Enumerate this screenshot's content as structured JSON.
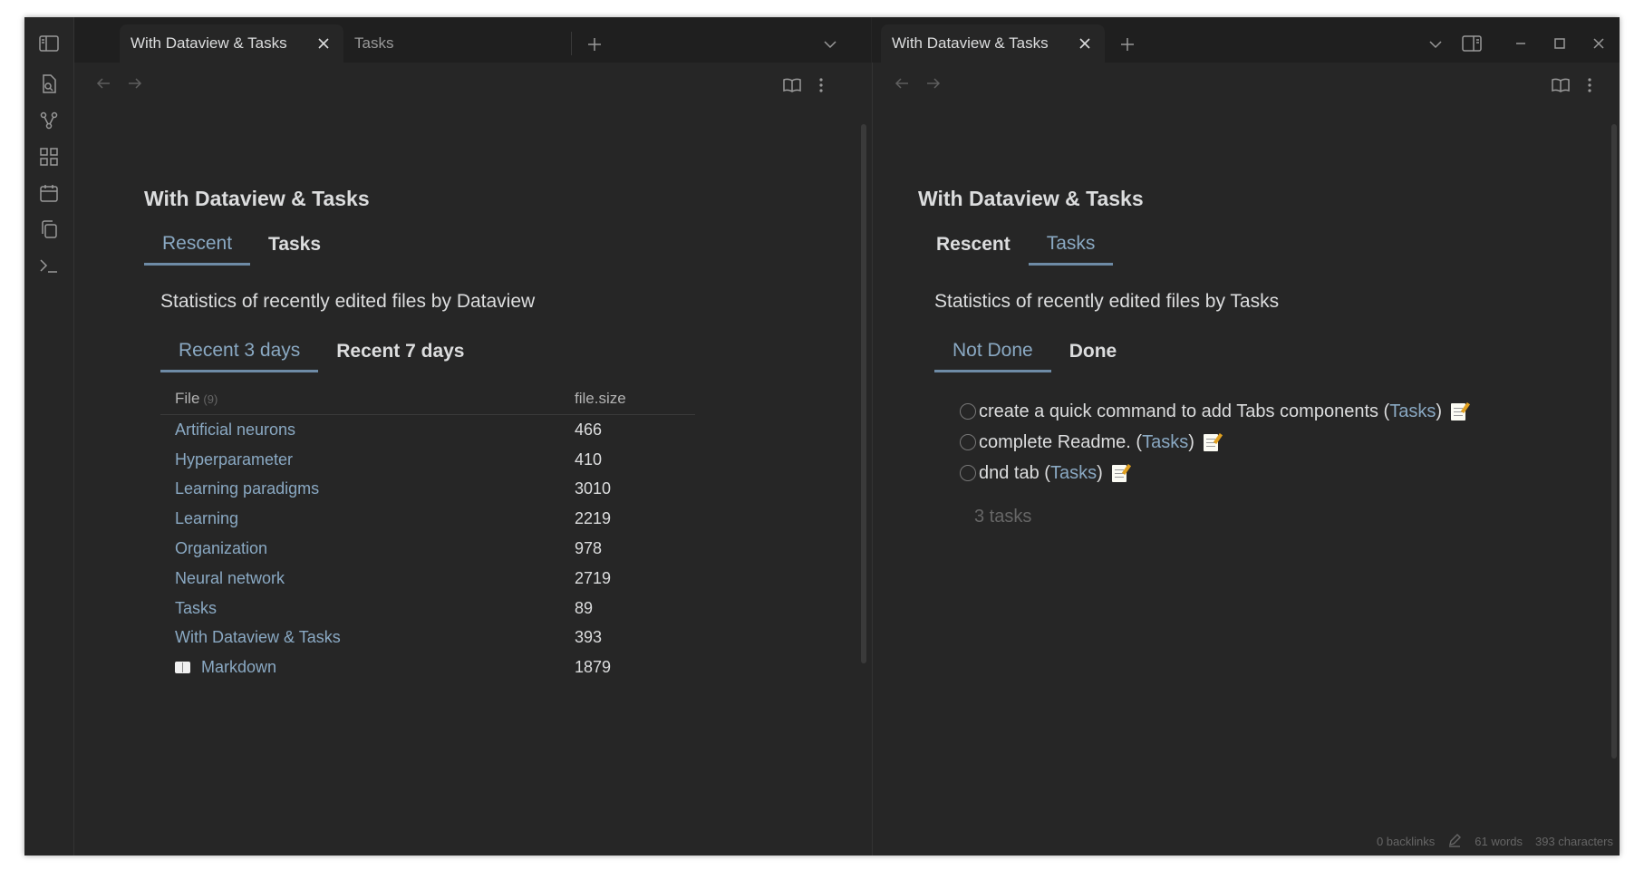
{
  "left_tabs": [
    {
      "label": "With Dataview & Tasks",
      "active": true
    },
    {
      "label": "Tasks",
      "active": false
    }
  ],
  "right_tabs": [
    {
      "label": "With Dataview & Tasks",
      "active": true
    }
  ],
  "ribbon_icons": [
    "sidebar-toggle-icon",
    "search-file-icon",
    "graph-icon",
    "grid-icon",
    "calendar-icon",
    "copy-icon",
    "terminal-icon"
  ],
  "left_pane": {
    "title": "With Dataview & Tasks",
    "tabs": [
      "Rescent",
      "Tasks"
    ],
    "stat_text": "Statistics of recently edited files by Dataview",
    "subtabs": [
      "Recent 3 days",
      "Recent 7 days"
    ],
    "table": {
      "col_file": "File",
      "file_count": "(9)",
      "col_size": "file.size",
      "rows": [
        {
          "name": "Artificial neurons",
          "size": "466"
        },
        {
          "name": "Hyperparameter",
          "size": "410"
        },
        {
          "name": "Learning paradigms",
          "size": "3010"
        },
        {
          "name": "Learning",
          "size": "2219"
        },
        {
          "name": "Organization",
          "size": "978"
        },
        {
          "name": "Neural network",
          "size": "2719"
        },
        {
          "name": "Tasks",
          "size": "89"
        },
        {
          "name": "With Dataview & Tasks",
          "size": "393"
        },
        {
          "name": "Markdown",
          "size": "1879"
        }
      ]
    }
  },
  "right_pane": {
    "title": "With Dataview & Tasks",
    "tabs": [
      "Rescent",
      "Tasks"
    ],
    "stat_text": "Statistics of recently edited files by Tasks",
    "subtabs": [
      "Not Done",
      "Done"
    ],
    "tasks": [
      {
        "text": "create a quick command to add Tabs components (",
        "link": "Tasks",
        "close": ")"
      },
      {
        "text": "complete Readme. (",
        "link": "Tasks",
        "close": ")"
      },
      {
        "text": "dnd tab (",
        "link": "Tasks",
        "close": ")"
      }
    ],
    "task_count": "3 tasks"
  },
  "status_bar": {
    "backlinks": "0 backlinks",
    "words": "61 words",
    "characters": "393 characters"
  },
  "colors": {
    "background": "#262626",
    "tabbar": "#1f1f1f",
    "accent": "#8aa9c3",
    "text": "#dcddde",
    "muted": "#666666"
  }
}
